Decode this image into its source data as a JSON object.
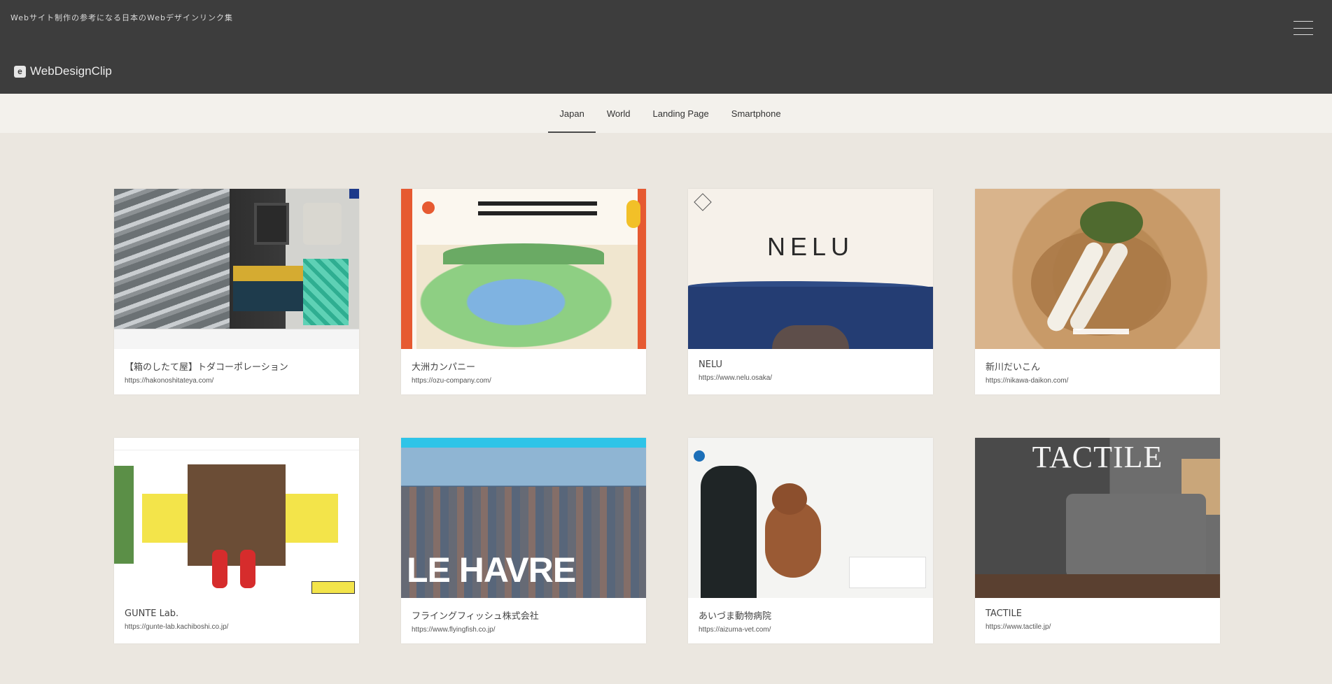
{
  "header": {
    "tagline": "Webサイト制作の参考になる日本のWebデザインリンク集",
    "logo_text": "WebDesignClip",
    "logo_mark": "e"
  },
  "nav": {
    "tabs": [
      {
        "label": "Japan",
        "active": true
      },
      {
        "label": "World",
        "active": false
      },
      {
        "label": "Landing Page",
        "active": false
      },
      {
        "label": "Smartphone",
        "active": false
      }
    ]
  },
  "cards": [
    {
      "title": "【箱のしたて屋】トダコーポレーション",
      "url": "https://hakonoshitateya.com/"
    },
    {
      "title": "大洲カンパニー",
      "url": "https://ozu-company.com/"
    },
    {
      "title": "NELU",
      "url": "https://www.nelu.osaka/",
      "thumb_text": "NELU"
    },
    {
      "title": "新川だいこん",
      "url": "https://nikawa-daikon.com/"
    },
    {
      "title": "GUNTE Lab.",
      "url": "https://gunte-lab.kachiboshi.co.jp/"
    },
    {
      "title": "フライングフィッシュ株式会社",
      "url": "https://www.flyingfish.co.jp/",
      "thumb_text": "LE HAVRE"
    },
    {
      "title": "あいづま動物病院",
      "url": "https://aizuma-vet.com/"
    },
    {
      "title": "TACTILE",
      "url": "https://www.tactile.jp/",
      "thumb_text": "TACTILE"
    }
  ],
  "icons": {
    "menu": "hamburger-icon",
    "logo": "webdesignclip-logo-icon"
  },
  "colors": {
    "header_bg": "#3d3d3d",
    "nav_bg": "#f3f1ec",
    "page_bg": "#ebe7e0",
    "card_bg": "#ffffff"
  }
}
